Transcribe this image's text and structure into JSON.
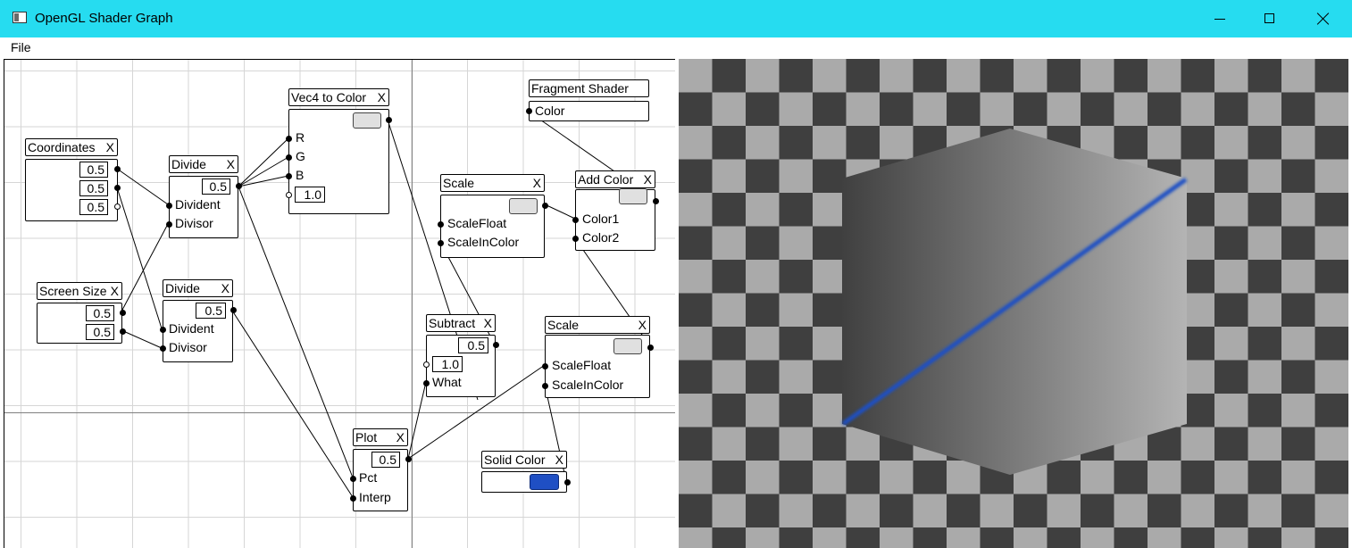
{
  "window": {
    "title": "OpenGL Shader Graph"
  },
  "menu": {
    "file": "File"
  },
  "close_glyph": "X",
  "nodes": {
    "coordinates": {
      "title": "Coordinates",
      "values": [
        "0.5",
        "0.5",
        "0.5"
      ]
    },
    "divide1": {
      "title": "Divide",
      "value": "0.5",
      "ports": [
        "Divident",
        "Divisor"
      ]
    },
    "screen_size": {
      "title": "Screen Size",
      "values": [
        "0.5",
        "0.5"
      ]
    },
    "divide2": {
      "title": "Divide",
      "value": "0.5",
      "ports": [
        "Divident",
        "Divisor"
      ]
    },
    "vec4_to_color": {
      "title": "Vec4 to Color",
      "ports": [
        "R",
        "G",
        "B"
      ],
      "a_value": "1.0"
    },
    "fragment_shader": {
      "title": "Fragment Shader",
      "port": "Color"
    },
    "scale1": {
      "title": "Scale",
      "ports": [
        "ScaleFloat",
        "ScaleInColor"
      ]
    },
    "add_color": {
      "title": "Add Color",
      "ports": [
        "Color1",
        "Color2"
      ]
    },
    "subtract": {
      "title": "Subtract",
      "value": "0.5",
      "second_value": "1.0",
      "port": "What"
    },
    "scale2": {
      "title": "Scale",
      "ports": [
        "ScaleFloat",
        "ScaleInColor"
      ]
    },
    "plot": {
      "title": "Plot",
      "value": "0.5",
      "ports": [
        "Pct",
        "Interp"
      ]
    },
    "solid_color": {
      "title": "Solid Color"
    }
  },
  "colors": {
    "titlebar": "#26dcf0",
    "swatch_default": "#e0e0e0",
    "solid_color_swatch": "#1f4fc4",
    "checker_dark": "#3f3f3f",
    "checker_light": "#aaaaaa",
    "plot_line": "#1f4fc4"
  },
  "icons": {
    "app": "app-window-icon",
    "minimize": "minimize-icon",
    "maximize": "maximize-icon",
    "close": "close-icon"
  }
}
